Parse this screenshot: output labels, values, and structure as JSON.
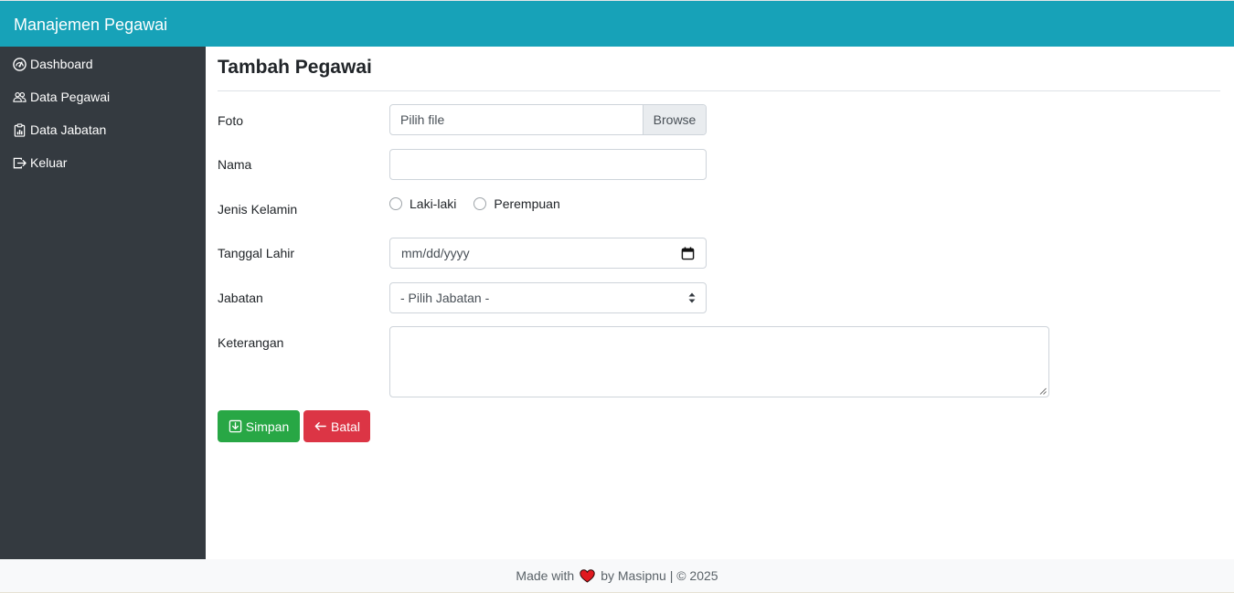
{
  "app": {
    "brand": "Manajemen Pegawai"
  },
  "sidebar": {
    "items": [
      {
        "label": "Dashboard",
        "icon": "dashboard-gauge-icon"
      },
      {
        "label": "Data Pegawai",
        "icon": "people-icon"
      },
      {
        "label": "Data Jabatan",
        "icon": "clipboard-chart-icon"
      },
      {
        "label": "Keluar",
        "icon": "logout-icon"
      }
    ]
  },
  "form": {
    "title": "Tambah Pegawai",
    "foto": {
      "label": "Foto",
      "placeholder": "Pilih file",
      "browse": "Browse"
    },
    "nama": {
      "label": "Nama",
      "value": ""
    },
    "jenis_kelamin": {
      "label": "Jenis Kelamin",
      "options": [
        "Laki-laki",
        "Perempuan"
      ]
    },
    "tanggal_lahir": {
      "label": "Tanggal Lahir",
      "placeholder": "mm/dd/yyyy"
    },
    "jabatan": {
      "label": "Jabatan",
      "selected": "- Pilih Jabatan -"
    },
    "keterangan": {
      "label": "Keterangan",
      "value": ""
    },
    "buttons": {
      "save": "Simpan",
      "cancel": "Batal"
    }
  },
  "footer": {
    "prefix": "Made with",
    "suffix": "by Masipnu | © 2025"
  },
  "colors": {
    "navbar": "#17a2b8",
    "sidebar": "#343a40",
    "save": "#28a745",
    "cancel": "#dc3545",
    "heart": "#e0191f"
  }
}
